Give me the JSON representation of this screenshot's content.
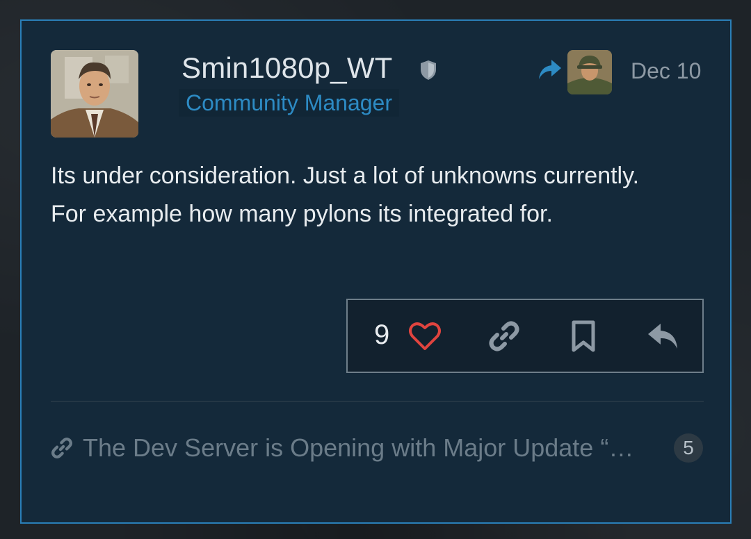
{
  "post": {
    "author": {
      "username": "Smin1080p_WT",
      "title": "Community Manager",
      "badge_icon": "shield-icon",
      "avatar_icon": "avatar-portrait"
    },
    "reply_to": {
      "icon": "reply-arrow-icon",
      "avatar_icon": "avatar-soldier"
    },
    "date": "Dec 10",
    "body": "Its under consideration. Just a lot of unknowns currently. For example how many pylons its integrated for.",
    "actions": {
      "like_count": "9",
      "like_icon": "heart-icon",
      "link_icon": "link-icon",
      "bookmark_icon": "bookmark-icon",
      "reply_icon": "reply-icon"
    },
    "linked_topic": {
      "icon": "link-icon",
      "title": "The Dev Server is Opening with Major Update “…",
      "count": "5"
    }
  },
  "colors": {
    "accent_border": "#2a7fb8",
    "title_blue": "#2d8bc4",
    "heart_red": "#e0443f",
    "background": "#14293a"
  }
}
